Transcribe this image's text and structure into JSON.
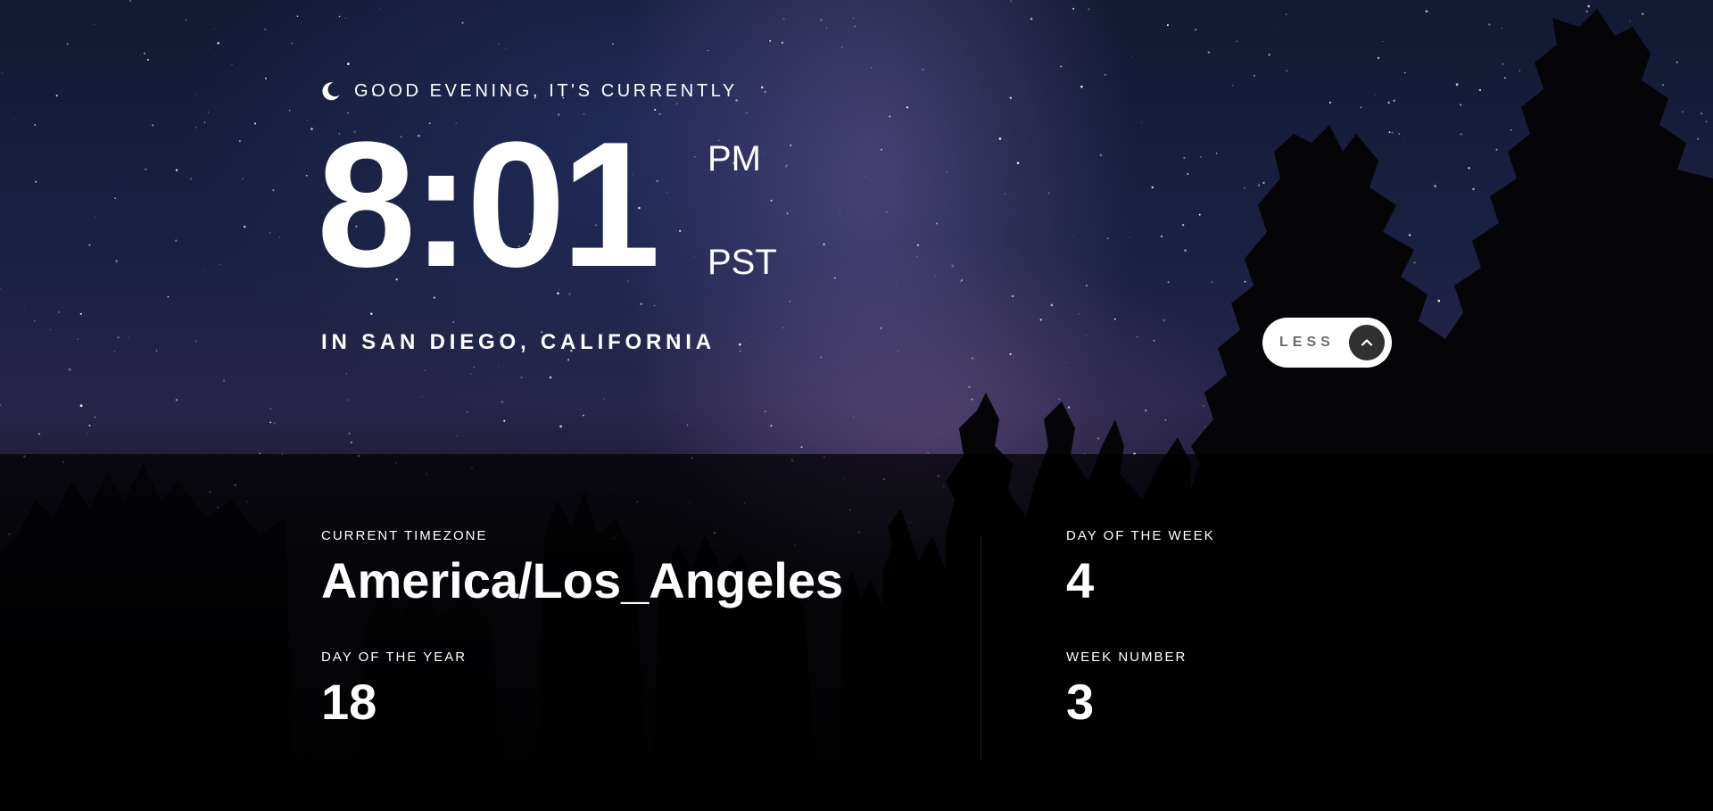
{
  "greeting": {
    "icon": "moon-icon",
    "text": "GOOD EVENING, IT'S CURRENTLY"
  },
  "clock": {
    "time": "8:01",
    "meridiem": "PM",
    "timezone_abbr": "PST"
  },
  "location": {
    "text": "IN SAN DIEGO, CALIFORNIA"
  },
  "toggle": {
    "label": "LESS",
    "icon": "chevron-up-icon"
  },
  "details": {
    "timezone": {
      "label": "CURRENT TIMEZONE",
      "value": "America/Los_Angeles"
    },
    "day_of_year": {
      "label": "DAY OF THE YEAR",
      "value": "18"
    },
    "day_of_week": {
      "label": "DAY OF THE WEEK",
      "value": "4"
    },
    "week_number": {
      "label": "WEEK NUMBER",
      "value": "3"
    }
  },
  "colors": {
    "text": "#ffffff",
    "button_bg": "#ffffff",
    "button_text": "#6b6b6b",
    "button_icon_bg": "#303030",
    "panel_bg": "#000000"
  }
}
